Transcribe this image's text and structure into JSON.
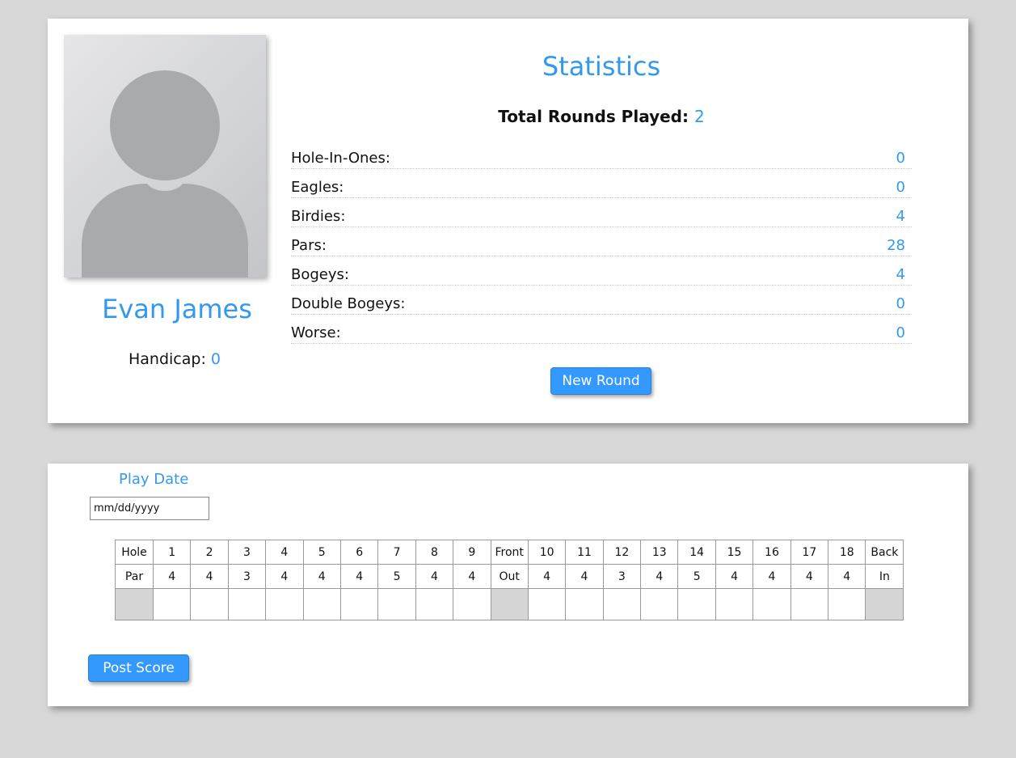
{
  "profile": {
    "name": "Evan James",
    "handicap_label": "Handicap:",
    "handicap_value": "0",
    "avatar_icon": "user-silhouette-icon"
  },
  "statistics": {
    "title": "Statistics",
    "total_rounds_label": "Total Rounds Played:",
    "total_rounds_value": "2",
    "rows": [
      {
        "label": "Hole-In-Ones:",
        "value": "0"
      },
      {
        "label": "Eagles:",
        "value": "0"
      },
      {
        "label": "Birdies:",
        "value": "4"
      },
      {
        "label": "Pars:",
        "value": "28"
      },
      {
        "label": "Bogeys:",
        "value": "4"
      },
      {
        "label": "Double Bogeys:",
        "value": "0"
      },
      {
        "label": "Worse:",
        "value": "0"
      }
    ],
    "new_round_label": "New Round"
  },
  "score_entry": {
    "play_date_label": "Play Date",
    "date_placeholder": "mm/dd/yyyy",
    "holes_row": [
      "Hole",
      "1",
      "2",
      "3",
      "4",
      "5",
      "6",
      "7",
      "8",
      "9",
      "Front",
      "10",
      "11",
      "12",
      "13",
      "14",
      "15",
      "16",
      "17",
      "18",
      "Back"
    ],
    "par_row": [
      "Par",
      "4",
      "4",
      "3",
      "4",
      "4",
      "4",
      "5",
      "4",
      "4",
      "Out",
      "4",
      "4",
      "3",
      "4",
      "5",
      "4",
      "4",
      "4",
      "4",
      "In"
    ],
    "post_score_label": "Post Score"
  },
  "colors": {
    "accent": "#3399ee",
    "button": "#3399ff",
    "background": "#d8d8d8"
  }
}
